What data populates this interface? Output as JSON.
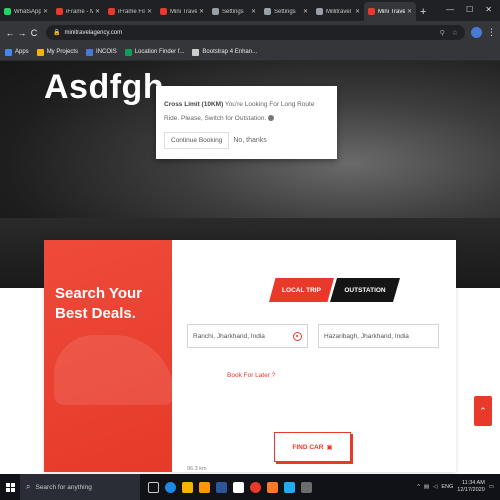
{
  "browser": {
    "tabs": [
      {
        "label": "WhatsApp",
        "color": "#25d366",
        "active": false
      },
      {
        "label": "iFrame - Main",
        "color": "#e8392a",
        "active": false
      },
      {
        "label": "iFrame File Me",
        "color": "#e8392a",
        "active": false
      },
      {
        "label": "Mini Travel",
        "color": "#e8392a",
        "active": false
      },
      {
        "label": "Settings",
        "color": "#9aa0a6",
        "active": false
      },
      {
        "label": "Settings",
        "color": "#9aa0a6",
        "active": false
      },
      {
        "label": "Millitravel",
        "color": "#9aa0a6",
        "active": false
      },
      {
        "label": "Mini Travel",
        "color": "#e8392a",
        "active": true
      }
    ],
    "new_tab_icon": "+",
    "url": "minitravelagency.com",
    "bookmarks": [
      {
        "label": "Apps",
        "color": "#4285f4"
      },
      {
        "label": "My Projects",
        "color": "#f4b400"
      },
      {
        "label": "INCOIS",
        "color": "#4a7bd4"
      },
      {
        "label": "Location Finder f...",
        "color": "#0f9d58"
      },
      {
        "label": "Bootstrap 4 Enhan...",
        "color": "#cccccc"
      }
    ]
  },
  "hero": {
    "title": "Asdfgh"
  },
  "popup": {
    "message_bold": "Cross Limit (10KM)",
    "message": " You're Looking For Long Route Ride. Please, Switch for Outstation.",
    "continue_label": "Continue Booking",
    "nothanks_label": "No, thanks"
  },
  "search": {
    "promo_title": "Search Your Best Deals.",
    "tab_local": "LOCAL TRIP",
    "tab_outstation": "OUTSTATION",
    "from_value": "Ranchi, Jharkhand, India",
    "to_value": "Hazaribagh, Jharkhand, India",
    "book_later": "Book For Later ?",
    "find_car": "FIND CAR",
    "distance": "96.3 km"
  },
  "taskbar": {
    "search_placeholder": "Search for anything",
    "time": "11:34 AM",
    "date": "12/17/2020",
    "lang": "ENG"
  },
  "colors": {
    "brand_red": "#e8392a",
    "dark": "#151515"
  }
}
